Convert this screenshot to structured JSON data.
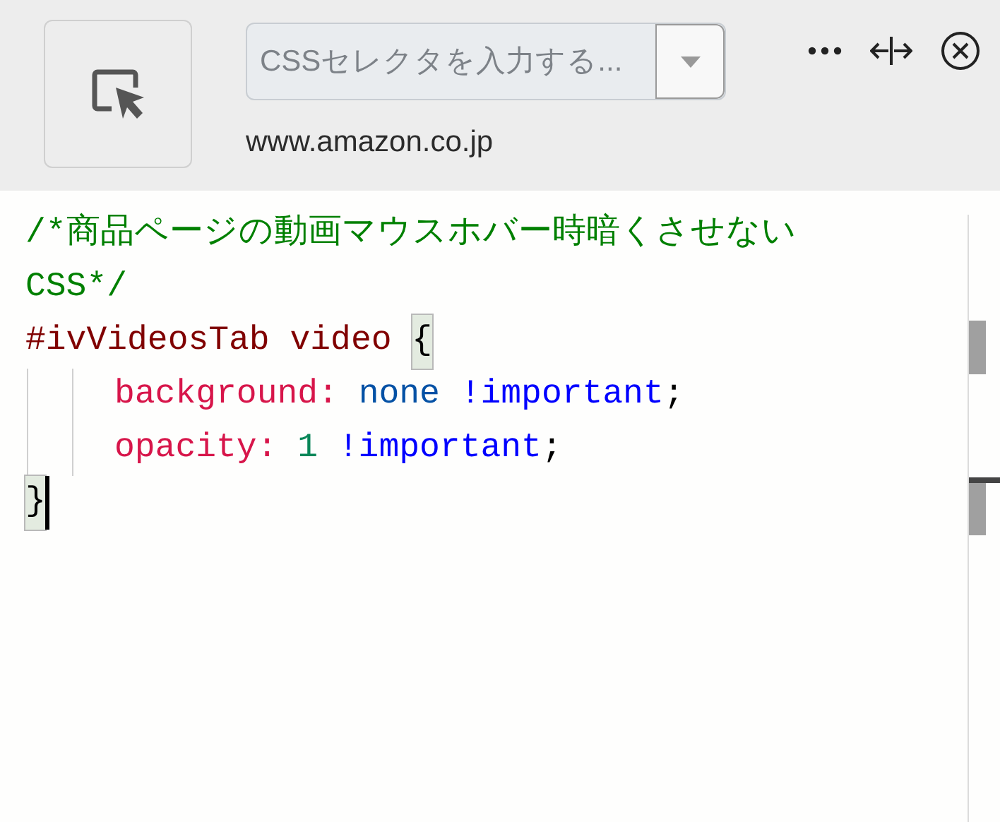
{
  "toolbar": {
    "selector_field": {
      "placeholder": "CSSセレクタを入力する..."
    },
    "site": "www.amazon.co.jp"
  },
  "editor": {
    "blocks": [
      {
        "kind": "comment",
        "text": "/*商品ページの動画マウスホバー時暗くさせない CSS*/"
      },
      {
        "kind": "rule",
        "selector": "#ivVideosTab video",
        "open_brace": {
          "text": "{",
          "highlighted": true
        },
        "declarations": [
          {
            "tokens": [
              {
                "kind": "property",
                "text": "background:"
              },
              {
                "kind": "keyword",
                "text": "none"
              },
              {
                "kind": "important",
                "text": "!important"
              },
              {
                "kind": "punct",
                "text": ";"
              }
            ]
          },
          {
            "tokens": [
              {
                "kind": "property",
                "text": "opacity:"
              },
              {
                "kind": "number",
                "text": "1"
              },
              {
                "kind": "important",
                "text": "!important"
              },
              {
                "kind": "punct",
                "text": ";"
              }
            ]
          }
        ],
        "close_brace": {
          "text": "}",
          "highlighted": true,
          "cursor": true
        }
      }
    ]
  }
}
